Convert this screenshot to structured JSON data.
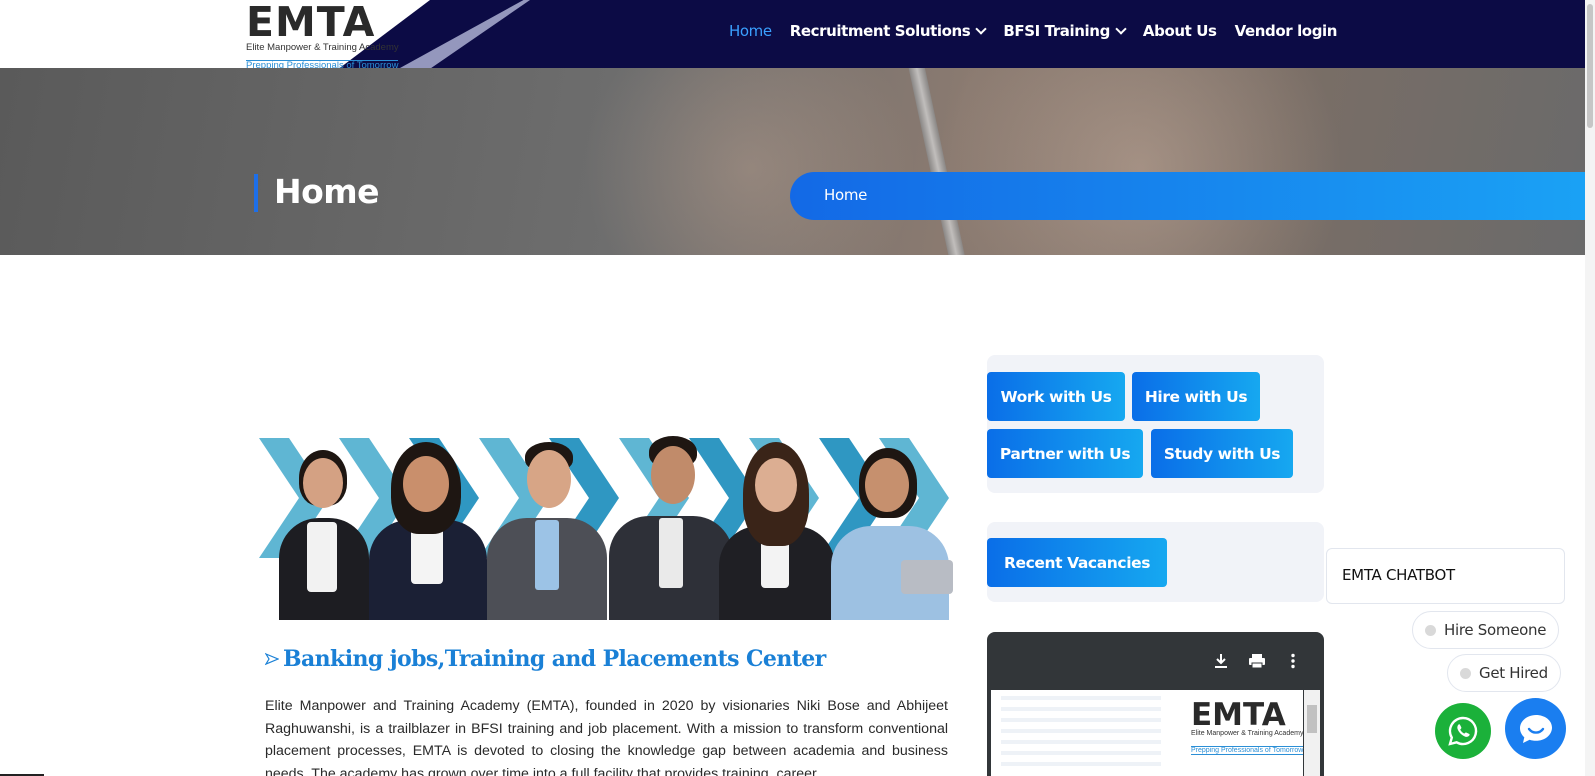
{
  "logo": {
    "wordmark": "EMTA",
    "subtitle": "Elite Manpower & Training Academy",
    "tagline": "Prepping Professionals of Tomorrow"
  },
  "nav": {
    "items": [
      {
        "label": "Home",
        "active": true,
        "dropdown": false
      },
      {
        "label": "Recruitment Solutions",
        "active": false,
        "dropdown": true
      },
      {
        "label": "BFSI Training",
        "active": false,
        "dropdown": true
      },
      {
        "label": "About Us",
        "active": false,
        "dropdown": false
      },
      {
        "label": "Vendor login",
        "active": false,
        "dropdown": false
      }
    ]
  },
  "banner": {
    "title": "Home",
    "breadcrumb": "Home"
  },
  "main": {
    "heading": "Banking jobs,Training and Placements Center",
    "paragraph": "Elite Manpower and Training Academy (EMTA), founded in 2020 by visionaries Niki Bose and Abhijeet Raghuwanshi, is a trailblazer in BFSI training and job placement. With a mission to transform conventional placement processes, EMTA is devoted to closing the knowledge gap between academia and business needs. The academy has grown over time into a full facility that provides training, career"
  },
  "sidebar": {
    "buttons": [
      "Work with Us",
      "Hire with Us",
      "Partner with Us",
      "Study with Us"
    ],
    "recent_vacancies": "Recent Vacancies"
  },
  "pdf_viewer": {
    "icons": [
      "download-icon",
      "print-icon",
      "more-vert-icon"
    ],
    "logo_word": "EMTA",
    "logo_sub": "Elite Manpower & Training Academy",
    "logo_tag": "Prepping Professionals of Tomorrow"
  },
  "chatbot": {
    "title": "EMTA CHATBOT",
    "options": [
      "Hire Someone",
      "Get Hired"
    ]
  },
  "colors": {
    "header_bg": "#0c0b45",
    "accent_blue": "#1a7ef0",
    "heading_blue": "#1a80d6",
    "whatsapp_green": "#1bb13a"
  }
}
